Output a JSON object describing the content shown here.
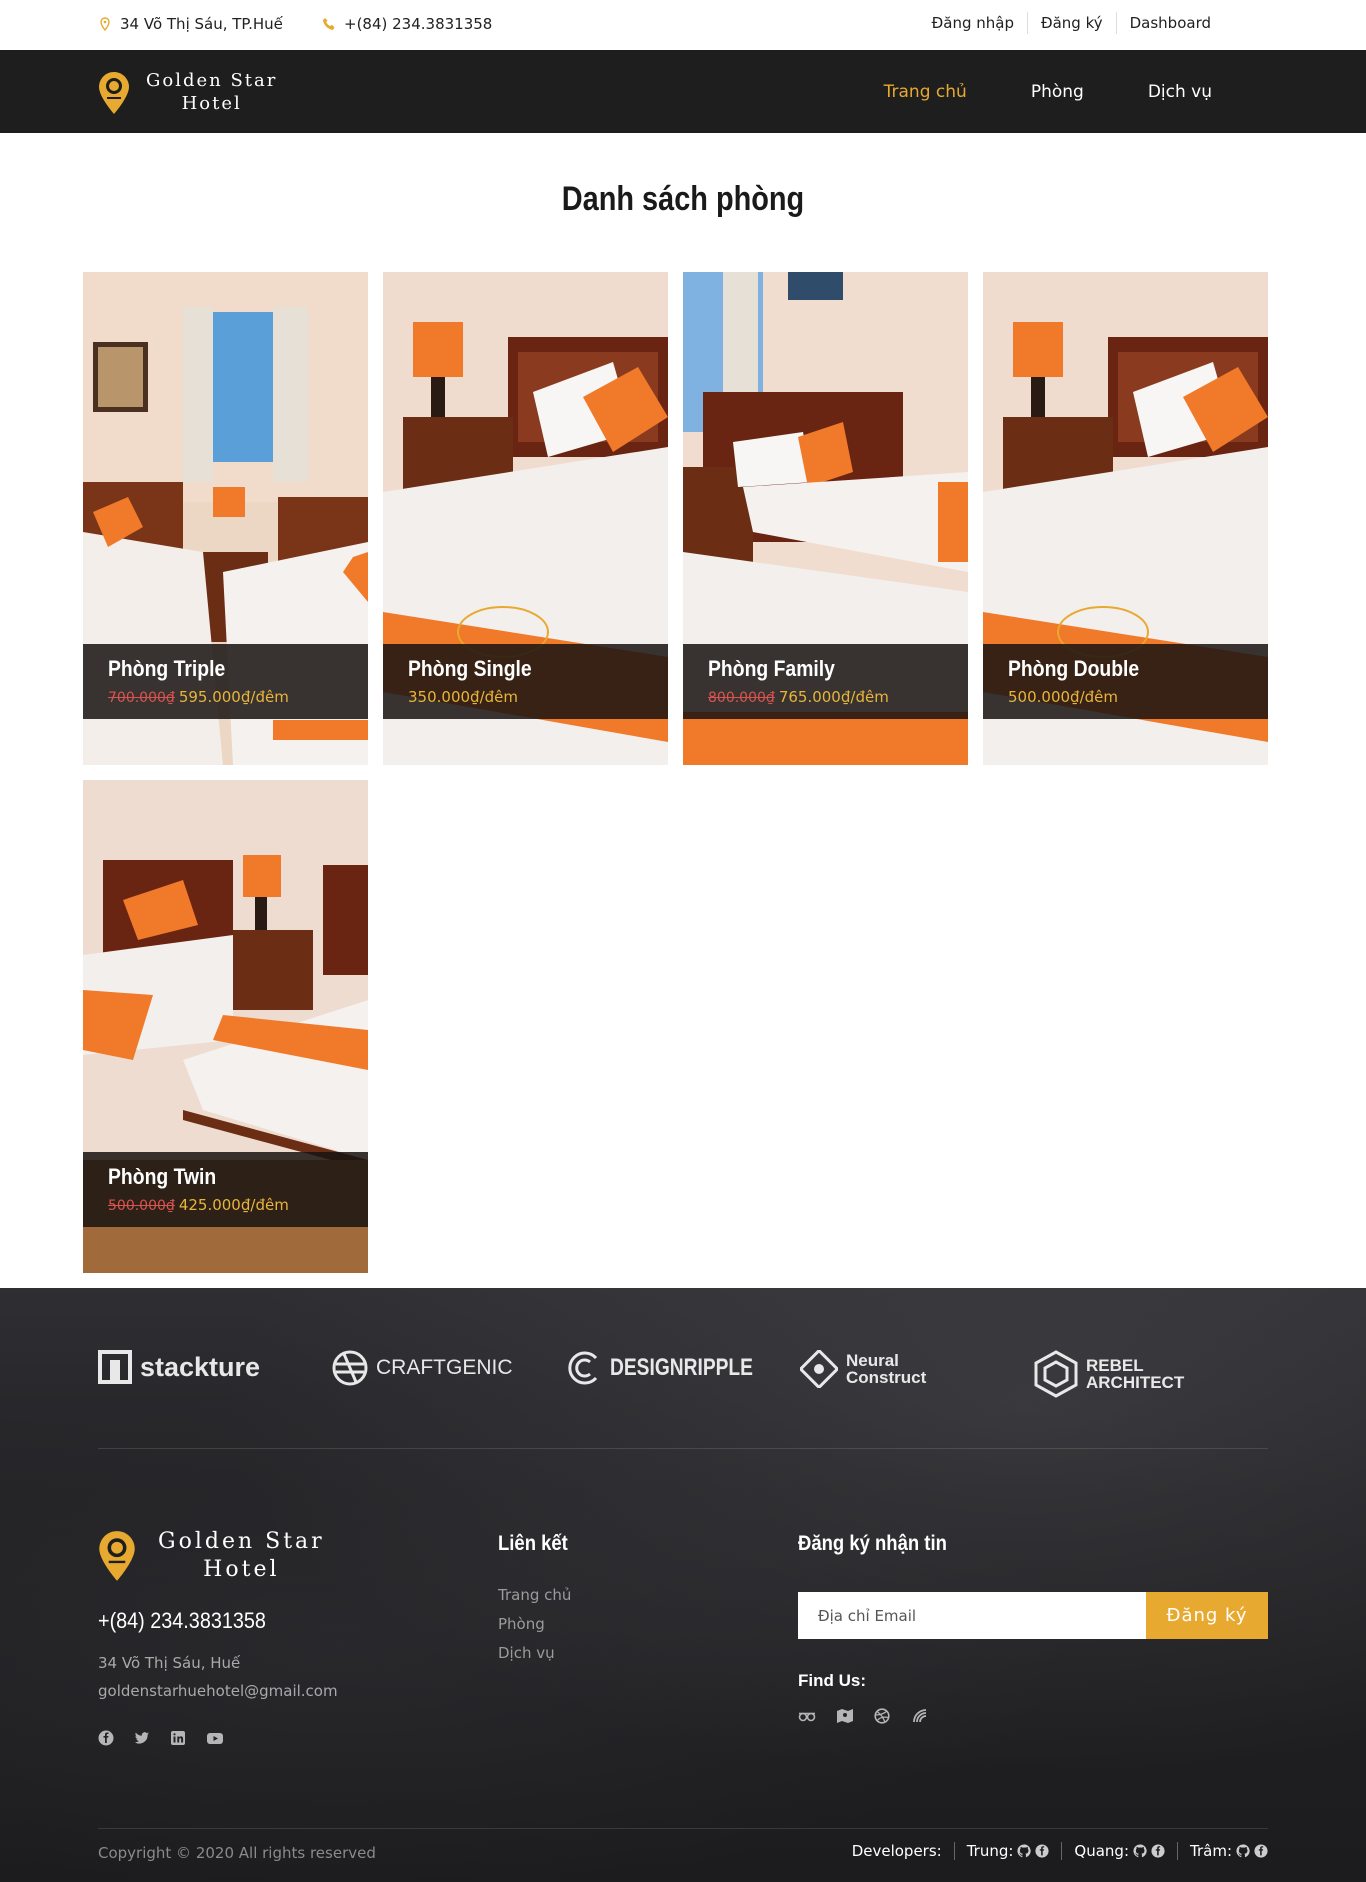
{
  "topbar": {
    "address": "34 Võ Thị Sáu, TP.Huế",
    "phone": "+(84) 234.3831358",
    "links": [
      "Đăng nhập",
      "Đăng ký",
      "Dashboard"
    ]
  },
  "header": {
    "logo_line1": "Golden Star",
    "logo_line2": "Hotel",
    "nav": [
      "Trang chủ",
      "Phòng",
      "Dịch vụ"
    ],
    "active_nav": "Trang chủ"
  },
  "main": {
    "title": "Danh sách phòng",
    "rooms": [
      {
        "name": "Phòng Triple",
        "old_price": "700.000₫",
        "price": "595.000₫/đêm"
      },
      {
        "name": "Phòng Single",
        "old_price": "",
        "price": "350.000₫/đêm"
      },
      {
        "name": "Phòng Family",
        "old_price": "800.000₫",
        "price": "765.000₫/đêm"
      },
      {
        "name": "Phòng Double",
        "old_price": "",
        "price": "500.000₫/đêm"
      },
      {
        "name": "Phòng Twin",
        "old_price": "500.000₫",
        "price": "425.000₫/đêm"
      }
    ]
  },
  "footer": {
    "brands": [
      "stackture",
      "CRAFTGENIC",
      "DESIGNRIPPLE",
      "Neural Construct",
      "REBEL ARCHITECT"
    ],
    "logo_line1": "Golden Star",
    "logo_line2": "Hotel",
    "phone": "+(84) 234.3831358",
    "address": "34 Võ Thị Sáu, Huế",
    "email": "goldenstarhuehotel@gmail.com",
    "links_heading": "Liên kết",
    "links": [
      "Trang chủ",
      "Phòng",
      "Dịch vụ"
    ],
    "newsletter_heading": "Đăng ký nhận tin",
    "email_placeholder": "Địa chỉ Email",
    "subscribe_label": "Đăng ký",
    "find_us": "Find Us:",
    "copyright": "Copyright © 2020 All rights reserved",
    "developers_label": "Developers:",
    "developers": [
      "Trung:",
      "Quang:",
      "Trâm:"
    ]
  },
  "colors": {
    "accent": "#e8a930",
    "dark": "#1e1e1e",
    "old_price": "#d9534f"
  }
}
